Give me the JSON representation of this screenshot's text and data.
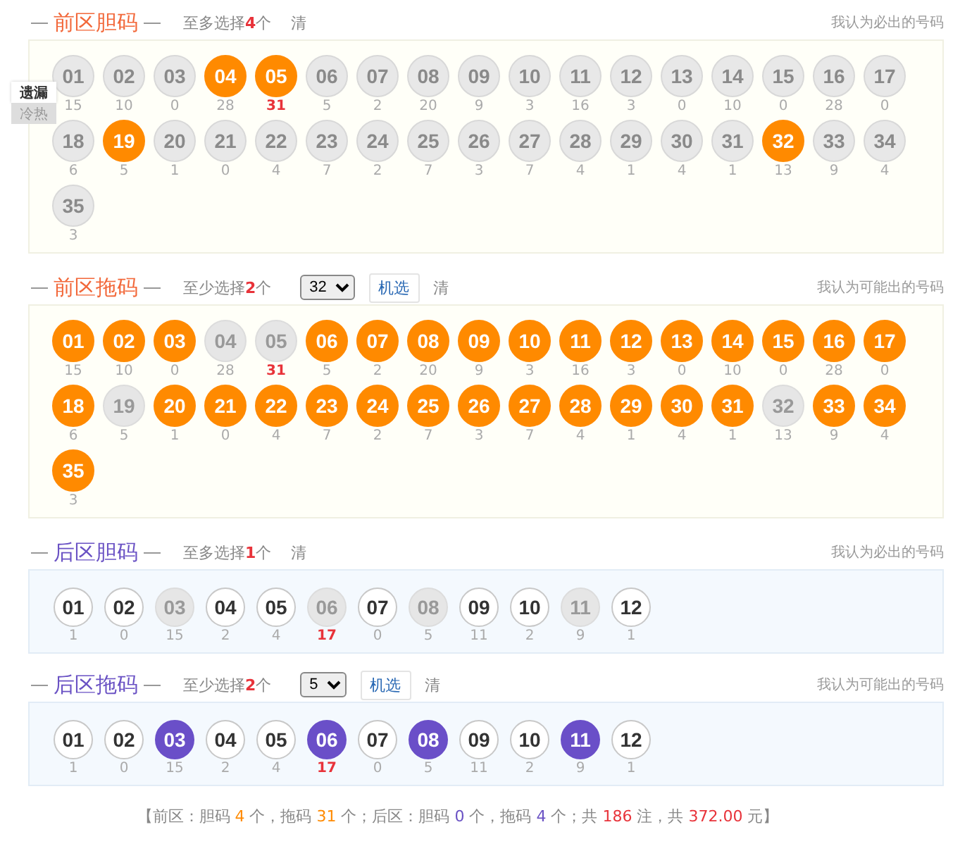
{
  "side_tabs": [
    {
      "label": "遗漏",
      "selected": true
    },
    {
      "label": "冷热",
      "selected": false
    }
  ],
  "sections": [
    {
      "kind": "front",
      "title": "前区胆码",
      "hint": {
        "before": "至多选择",
        "count": "4",
        "after": "个"
      },
      "clear": "清",
      "note": "我认为必出的号码",
      "rows": [
        [
          {
            "number": "01",
            "miss": "15",
            "selected": false,
            "blocked": false,
            "hot": false
          },
          {
            "number": "02",
            "miss": "10",
            "selected": false,
            "blocked": false,
            "hot": false
          },
          {
            "number": "03",
            "miss": "0",
            "selected": false,
            "blocked": false,
            "hot": false
          },
          {
            "number": "04",
            "miss": "28",
            "selected": true,
            "blocked": false,
            "hot": false
          },
          {
            "number": "05",
            "miss": "31",
            "selected": true,
            "blocked": false,
            "hot": true
          },
          {
            "number": "06",
            "miss": "5",
            "selected": false,
            "blocked": false,
            "hot": false
          },
          {
            "number": "07",
            "miss": "2",
            "selected": false,
            "blocked": false,
            "hot": false
          },
          {
            "number": "08",
            "miss": "20",
            "selected": false,
            "blocked": false,
            "hot": false
          },
          {
            "number": "09",
            "miss": "9",
            "selected": false,
            "blocked": false,
            "hot": false
          },
          {
            "number": "10",
            "miss": "3",
            "selected": false,
            "blocked": false,
            "hot": false
          },
          {
            "number": "11",
            "miss": "16",
            "selected": false,
            "blocked": false,
            "hot": false
          },
          {
            "number": "12",
            "miss": "3",
            "selected": false,
            "blocked": false,
            "hot": false
          },
          {
            "number": "13",
            "miss": "0",
            "selected": false,
            "blocked": false,
            "hot": false
          },
          {
            "number": "14",
            "miss": "10",
            "selected": false,
            "blocked": false,
            "hot": false
          },
          {
            "number": "15",
            "miss": "0",
            "selected": false,
            "blocked": false,
            "hot": false
          },
          {
            "number": "16",
            "miss": "28",
            "selected": false,
            "blocked": false,
            "hot": false
          },
          {
            "number": "17",
            "miss": "0",
            "selected": false,
            "blocked": false,
            "hot": false
          }
        ],
        [
          {
            "number": "18",
            "miss": "6",
            "selected": false,
            "blocked": false,
            "hot": false
          },
          {
            "number": "19",
            "miss": "5",
            "selected": true,
            "blocked": false,
            "hot": false
          },
          {
            "number": "20",
            "miss": "1",
            "selected": false,
            "blocked": false,
            "hot": false
          },
          {
            "number": "21",
            "miss": "0",
            "selected": false,
            "blocked": false,
            "hot": false
          },
          {
            "number": "22",
            "miss": "4",
            "selected": false,
            "blocked": false,
            "hot": false
          },
          {
            "number": "23",
            "miss": "7",
            "selected": false,
            "blocked": false,
            "hot": false
          },
          {
            "number": "24",
            "miss": "2",
            "selected": false,
            "blocked": false,
            "hot": false
          },
          {
            "number": "25",
            "miss": "7",
            "selected": false,
            "blocked": false,
            "hot": false
          },
          {
            "number": "26",
            "miss": "3",
            "selected": false,
            "blocked": false,
            "hot": false
          },
          {
            "number": "27",
            "miss": "7",
            "selected": false,
            "blocked": false,
            "hot": false
          },
          {
            "number": "28",
            "miss": "4",
            "selected": false,
            "blocked": false,
            "hot": false
          },
          {
            "number": "29",
            "miss": "1",
            "selected": false,
            "blocked": false,
            "hot": false
          },
          {
            "number": "30",
            "miss": "4",
            "selected": false,
            "blocked": false,
            "hot": false
          },
          {
            "number": "31",
            "miss": "1",
            "selected": false,
            "blocked": false,
            "hot": false
          },
          {
            "number": "32",
            "miss": "13",
            "selected": true,
            "blocked": false,
            "hot": false
          },
          {
            "number": "33",
            "miss": "9",
            "selected": false,
            "blocked": false,
            "hot": false
          },
          {
            "number": "34",
            "miss": "4",
            "selected": false,
            "blocked": false,
            "hot": false
          }
        ],
        [
          {
            "number": "35",
            "miss": "3",
            "selected": false,
            "blocked": false,
            "hot": false
          }
        ]
      ]
    },
    {
      "kind": "front",
      "title": "前区拖码",
      "hint": {
        "before": "至少选择",
        "count": "2",
        "after": "个"
      },
      "select": "32",
      "random": "机选",
      "clear": "清",
      "note": "我认为可能出的号码",
      "rows": [
        [
          {
            "number": "01",
            "miss": "15",
            "selected": true,
            "blocked": false,
            "hot": false
          },
          {
            "number": "02",
            "miss": "10",
            "selected": true,
            "blocked": false,
            "hot": false
          },
          {
            "number": "03",
            "miss": "0",
            "selected": true,
            "blocked": false,
            "hot": false
          },
          {
            "number": "04",
            "miss": "28",
            "selected": false,
            "blocked": true,
            "hot": false
          },
          {
            "number": "05",
            "miss": "31",
            "selected": false,
            "blocked": true,
            "hot": true
          },
          {
            "number": "06",
            "miss": "5",
            "selected": true,
            "blocked": false,
            "hot": false
          },
          {
            "number": "07",
            "miss": "2",
            "selected": true,
            "blocked": false,
            "hot": false
          },
          {
            "number": "08",
            "miss": "20",
            "selected": true,
            "blocked": false,
            "hot": false
          },
          {
            "number": "09",
            "miss": "9",
            "selected": true,
            "blocked": false,
            "hot": false
          },
          {
            "number": "10",
            "miss": "3",
            "selected": true,
            "blocked": false,
            "hot": false
          },
          {
            "number": "11",
            "miss": "16",
            "selected": true,
            "blocked": false,
            "hot": false
          },
          {
            "number": "12",
            "miss": "3",
            "selected": true,
            "blocked": false,
            "hot": false
          },
          {
            "number": "13",
            "miss": "0",
            "selected": true,
            "blocked": false,
            "hot": false
          },
          {
            "number": "14",
            "miss": "10",
            "selected": true,
            "blocked": false,
            "hot": false
          },
          {
            "number": "15",
            "miss": "0",
            "selected": true,
            "blocked": false,
            "hot": false
          },
          {
            "number": "16",
            "miss": "28",
            "selected": true,
            "blocked": false,
            "hot": false
          },
          {
            "number": "17",
            "miss": "0",
            "selected": true,
            "blocked": false,
            "hot": false
          }
        ],
        [
          {
            "number": "18",
            "miss": "6",
            "selected": true,
            "blocked": false,
            "hot": false
          },
          {
            "number": "19",
            "miss": "5",
            "selected": false,
            "blocked": true,
            "hot": false
          },
          {
            "number": "20",
            "miss": "1",
            "selected": true,
            "blocked": false,
            "hot": false
          },
          {
            "number": "21",
            "miss": "0",
            "selected": true,
            "blocked": false,
            "hot": false
          },
          {
            "number": "22",
            "miss": "4",
            "selected": true,
            "blocked": false,
            "hot": false
          },
          {
            "number": "23",
            "miss": "7",
            "selected": true,
            "blocked": false,
            "hot": false
          },
          {
            "number": "24",
            "miss": "2",
            "selected": true,
            "blocked": false,
            "hot": false
          },
          {
            "number": "25",
            "miss": "7",
            "selected": true,
            "blocked": false,
            "hot": false
          },
          {
            "number": "26",
            "miss": "3",
            "selected": true,
            "blocked": false,
            "hot": false
          },
          {
            "number": "27",
            "miss": "7",
            "selected": true,
            "blocked": false,
            "hot": false
          },
          {
            "number": "28",
            "miss": "4",
            "selected": true,
            "blocked": false,
            "hot": false
          },
          {
            "number": "29",
            "miss": "1",
            "selected": true,
            "blocked": false,
            "hot": false
          },
          {
            "number": "30",
            "miss": "4",
            "selected": true,
            "blocked": false,
            "hot": false
          },
          {
            "number": "31",
            "miss": "1",
            "selected": true,
            "blocked": false,
            "hot": false
          },
          {
            "number": "32",
            "miss": "13",
            "selected": false,
            "blocked": true,
            "hot": false
          },
          {
            "number": "33",
            "miss": "9",
            "selected": true,
            "blocked": false,
            "hot": false
          },
          {
            "number": "34",
            "miss": "4",
            "selected": true,
            "blocked": false,
            "hot": false
          }
        ],
        [
          {
            "number": "35",
            "miss": "3",
            "selected": true,
            "blocked": false,
            "hot": false
          }
        ]
      ]
    },
    {
      "kind": "back",
      "title": "后区胆码",
      "hint": {
        "before": "至多选择",
        "count": "1",
        "after": "个"
      },
      "clear": "清",
      "note": "我认为必出的号码",
      "rows": [
        [
          {
            "number": "01",
            "miss": "1",
            "selected": false,
            "blocked": false,
            "hot": false
          },
          {
            "number": "02",
            "miss": "0",
            "selected": false,
            "blocked": false,
            "hot": false
          },
          {
            "number": "03",
            "miss": "15",
            "selected": false,
            "blocked": true,
            "hot": false
          },
          {
            "number": "04",
            "miss": "2",
            "selected": false,
            "blocked": false,
            "hot": false
          },
          {
            "number": "05",
            "miss": "4",
            "selected": false,
            "blocked": false,
            "hot": false
          },
          {
            "number": "06",
            "miss": "17",
            "selected": false,
            "blocked": true,
            "hot": true
          },
          {
            "number": "07",
            "miss": "0",
            "selected": false,
            "blocked": false,
            "hot": false
          },
          {
            "number": "08",
            "miss": "5",
            "selected": false,
            "blocked": true,
            "hot": false
          },
          {
            "number": "09",
            "miss": "11",
            "selected": false,
            "blocked": false,
            "hot": false
          },
          {
            "number": "10",
            "miss": "2",
            "selected": false,
            "blocked": false,
            "hot": false
          },
          {
            "number": "11",
            "miss": "9",
            "selected": false,
            "blocked": true,
            "hot": false
          },
          {
            "number": "12",
            "miss": "1",
            "selected": false,
            "blocked": false,
            "hot": false
          }
        ]
      ]
    },
    {
      "kind": "back",
      "title": "后区拖码",
      "hint": {
        "before": "至少选择",
        "count": "2",
        "after": "个"
      },
      "select": "5",
      "random": "机选",
      "clear": "清",
      "note": "我认为可能出的号码",
      "rows": [
        [
          {
            "number": "01",
            "miss": "1",
            "selected": false,
            "blocked": false,
            "hot": false
          },
          {
            "number": "02",
            "miss": "0",
            "selected": false,
            "blocked": false,
            "hot": false
          },
          {
            "number": "03",
            "miss": "15",
            "selected": true,
            "blocked": false,
            "hot": false
          },
          {
            "number": "04",
            "miss": "2",
            "selected": false,
            "blocked": false,
            "hot": false
          },
          {
            "number": "05",
            "miss": "4",
            "selected": false,
            "blocked": false,
            "hot": false
          },
          {
            "number": "06",
            "miss": "17",
            "selected": true,
            "blocked": false,
            "hot": true
          },
          {
            "number": "07",
            "miss": "0",
            "selected": false,
            "blocked": false,
            "hot": false
          },
          {
            "number": "08",
            "miss": "5",
            "selected": true,
            "blocked": false,
            "hot": false
          },
          {
            "number": "09",
            "miss": "11",
            "selected": false,
            "blocked": false,
            "hot": false
          },
          {
            "number": "10",
            "miss": "2",
            "selected": false,
            "blocked": false,
            "hot": false
          },
          {
            "number": "11",
            "miss": "9",
            "selected": true,
            "blocked": false,
            "hot": false
          },
          {
            "number": "12",
            "miss": "1",
            "selected": false,
            "blocked": false,
            "hot": false
          }
        ]
      ]
    }
  ],
  "summary": [
    {
      "text": "【前区：胆码 ",
      "kind": "plain"
    },
    {
      "text": "4",
      "kind": "front"
    },
    {
      "text": " 个，拖码 ",
      "kind": "plain"
    },
    {
      "text": "31",
      "kind": "front"
    },
    {
      "text": " 个；后区：胆码 ",
      "kind": "plain"
    },
    {
      "text": "0",
      "kind": "back"
    },
    {
      "text": " 个，拖码 ",
      "kind": "plain"
    },
    {
      "text": "4",
      "kind": "back"
    },
    {
      "text": " 个；共 ",
      "kind": "plain"
    },
    {
      "text": "186",
      "kind": "total"
    },
    {
      "text": " 注，共 ",
      "kind": "plain"
    },
    {
      "text": "372.00",
      "kind": "total"
    },
    {
      "text": " 元】",
      "kind": "plain"
    }
  ]
}
